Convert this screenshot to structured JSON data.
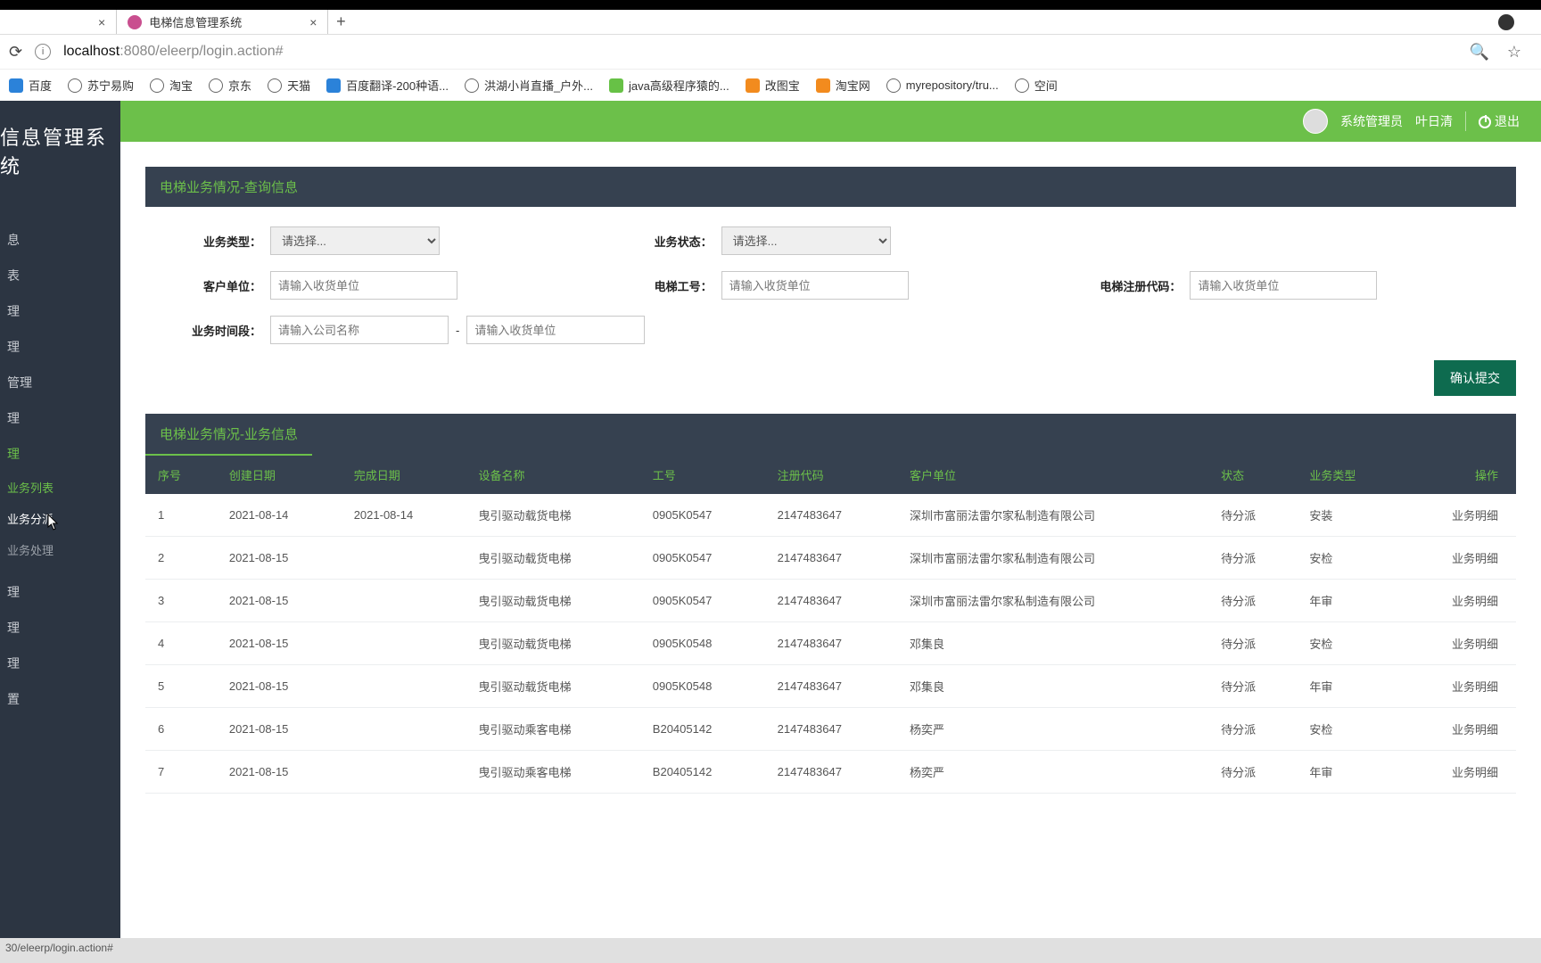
{
  "browser": {
    "tabs": [
      {
        "title": ""
      },
      {
        "title": "电梯信息管理系统"
      }
    ],
    "url_host": "localhost",
    "url_port": ":8080",
    "url_path": "/eleerp/login.action#"
  },
  "bookmarks": [
    "百度",
    "苏宁易购",
    "淘宝",
    "京东",
    "天猫",
    "百度翻译-200种语...",
    "洪湖小肖直播_户外...",
    "java高级程序猿的...",
    "改图宝",
    "淘宝网",
    "myrepository/tru...",
    "空间"
  ],
  "brand": "信息管理系统",
  "topbar": {
    "role": "系统管理员",
    "user": "叶日清",
    "logout": "退出"
  },
  "sidebar": {
    "items": [
      "息",
      "表",
      "理",
      "理",
      "管理",
      "理",
      "理"
    ],
    "subs": [
      "业务列表",
      "业务分派",
      "业务处理"
    ],
    "tail": [
      "理",
      "理",
      "理",
      "置"
    ]
  },
  "panel": {
    "query_title": "电梯业务情况-查询信息",
    "list_title": "电梯业务情况-业务信息"
  },
  "filters": {
    "label_btype": "业务类型：",
    "label_bstatus": "业务状态：",
    "label_customer": "客户单位：",
    "label_workno": "电梯工号：",
    "label_regcode": "电梯注册代码：",
    "label_period": "业务时间段：",
    "select_placeholder": "请选择...",
    "ph_receiver": "请输入收货单位",
    "ph_company": "请输入公司名称",
    "submit": "确认提交"
  },
  "table": {
    "headers": [
      "序号",
      "创建日期",
      "完成日期",
      "设备名称",
      "工号",
      "注册代码",
      "客户单位",
      "状态",
      "业务类型",
      "操作"
    ],
    "rows": [
      [
        "1",
        "2021-08-14",
        "2021-08-14",
        "曳引驱动载货电梯",
        "0905K0547",
        "2147483647",
        "深圳市富丽法雷尔家私制造有限公司",
        "待分派",
        "安装",
        "业务明细"
      ],
      [
        "2",
        "2021-08-15",
        "",
        "曳引驱动载货电梯",
        "0905K0547",
        "2147483647",
        "深圳市富丽法雷尔家私制造有限公司",
        "待分派",
        "安检",
        "业务明细"
      ],
      [
        "3",
        "2021-08-15",
        "",
        "曳引驱动载货电梯",
        "0905K0547",
        "2147483647",
        "深圳市富丽法雷尔家私制造有限公司",
        "待分派",
        "年审",
        "业务明细"
      ],
      [
        "4",
        "2021-08-15",
        "",
        "曳引驱动载货电梯",
        "0905K0548",
        "2147483647",
        "邓集良",
        "待分派",
        "安检",
        "业务明细"
      ],
      [
        "5",
        "2021-08-15",
        "",
        "曳引驱动载货电梯",
        "0905K0548",
        "2147483647",
        "邓集良",
        "待分派",
        "年审",
        "业务明细"
      ],
      [
        "6",
        "2021-08-15",
        "",
        "曳引驱动乘客电梯",
        "B20405142",
        "2147483647",
        "杨奕严",
        "待分派",
        "安检",
        "业务明细"
      ],
      [
        "7",
        "2021-08-15",
        "",
        "曳引驱动乘客电梯",
        "B20405142",
        "2147483647",
        "杨奕严",
        "待分派",
        "年审",
        "业务明细"
      ]
    ]
  },
  "status_url": "30/eleerp/login.action#"
}
